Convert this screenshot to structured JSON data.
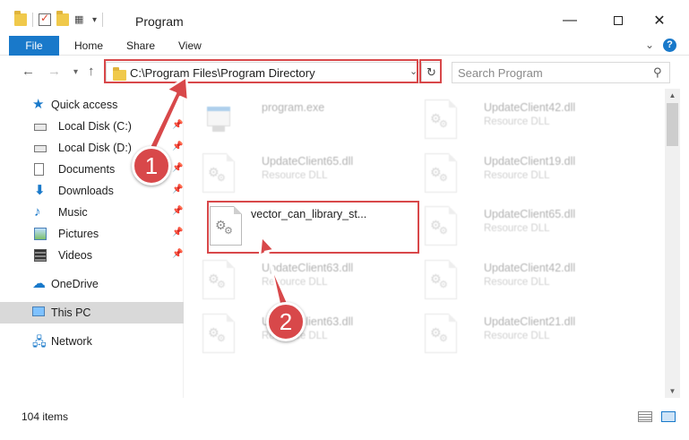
{
  "window": {
    "title": "Program"
  },
  "ribbon": {
    "tabs": [
      "File",
      "Home",
      "Share",
      "View"
    ]
  },
  "address_bar": {
    "path": "C:\\Program Files\\Program Directory",
    "search_placeholder": "Search Program"
  },
  "sidebar": {
    "quick_access": "Quick access",
    "items": [
      {
        "label": "Local Disk (C:)",
        "icon": "disk-icon",
        "pinned": true
      },
      {
        "label": "Local Disk (D:)",
        "icon": "disk-icon",
        "pinned": true
      },
      {
        "label": "Documents",
        "icon": "documents-icon",
        "pinned": true
      },
      {
        "label": "Downloads",
        "icon": "downloads-icon",
        "pinned": true
      },
      {
        "label": "Music",
        "icon": "music-icon",
        "pinned": true
      },
      {
        "label": "Pictures",
        "icon": "pictures-icon",
        "pinned": true
      },
      {
        "label": "Videos",
        "icon": "videos-icon",
        "pinned": true
      }
    ],
    "onedrive": "OneDrive",
    "this_pc": "This PC",
    "network": "Network"
  },
  "files": [
    {
      "name": "program.exe",
      "type": "",
      "kind": "exe",
      "faded": true
    },
    {
      "name": "UpdateClient42.dll",
      "type": "Resource DLL",
      "kind": "dll",
      "faded": true
    },
    {
      "name": "UpdateClient65.dll",
      "type": "Resource DLL",
      "kind": "dll",
      "faded": true
    },
    {
      "name": "UpdateClient19.dll",
      "type": "Resource DLL",
      "kind": "dll",
      "faded": true
    },
    {
      "name": "vector_can_library_st...",
      "type": "",
      "kind": "dll",
      "faded": false
    },
    {
      "name": "UpdateClient65.dll",
      "type": "Resource DLL",
      "kind": "dll",
      "faded": true
    },
    {
      "name": "UpdateClient63.dll",
      "type": "Resource DLL",
      "kind": "dll",
      "faded": true
    },
    {
      "name": "UpdateClient42.dll",
      "type": "Resource DLL",
      "kind": "dll",
      "faded": true
    },
    {
      "name": "UpdateClient63.dll",
      "type": "Resource DLL",
      "kind": "dll",
      "faded": true
    },
    {
      "name": "UpdateClient21.dll",
      "type": "Resource DLL",
      "kind": "dll",
      "faded": true
    }
  ],
  "status": {
    "item_count": "104 items"
  },
  "annotations": {
    "step1": "1",
    "step2": "2",
    "highlight_color": "#d8484a"
  },
  "colors": {
    "accent": "#1979ca",
    "selection": "#d9d9d9"
  }
}
